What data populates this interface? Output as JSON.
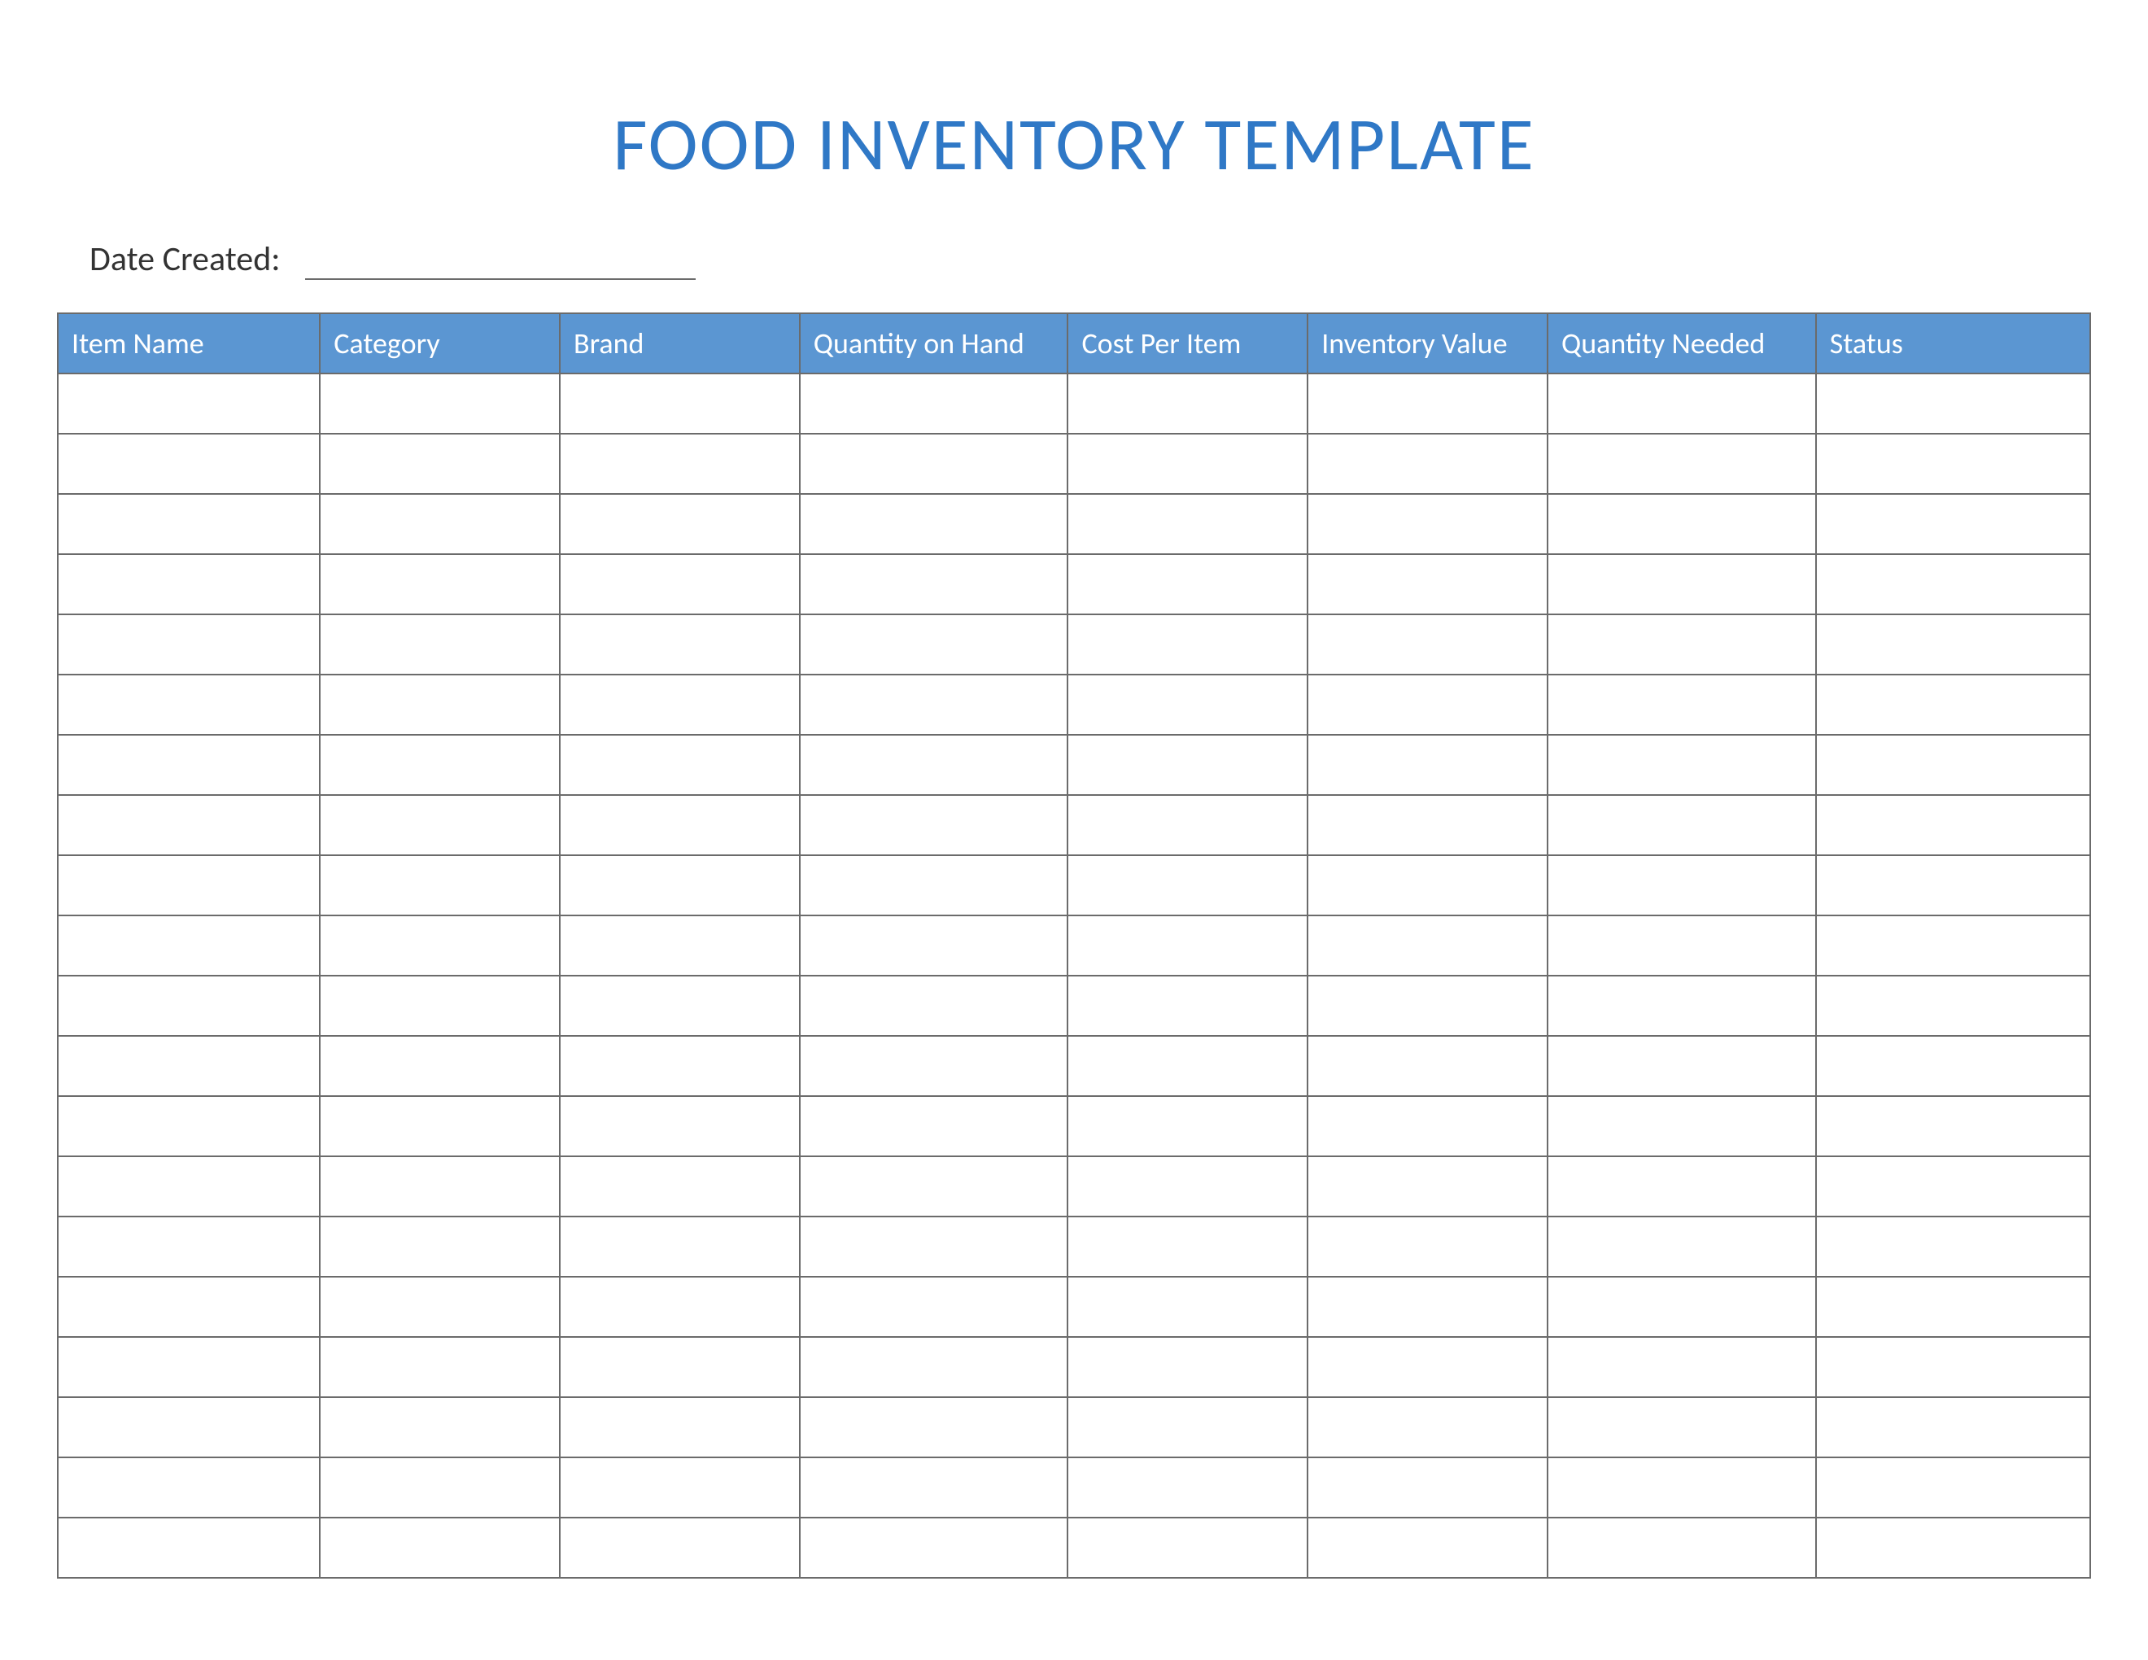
{
  "title": "FOOD INVENTORY TEMPLATE",
  "date_label": "Date Created:",
  "date_value": "",
  "columns": [
    "Item Name",
    "Category",
    "Brand",
    "Quantity on Hand",
    "Cost Per Item",
    "Inventory Value",
    "Quantity Needed",
    "Status"
  ],
  "row_count": 20,
  "colors": {
    "header_bg": "#5b96d2",
    "title": "#2f78c6",
    "border": "#6b6b6b"
  }
}
